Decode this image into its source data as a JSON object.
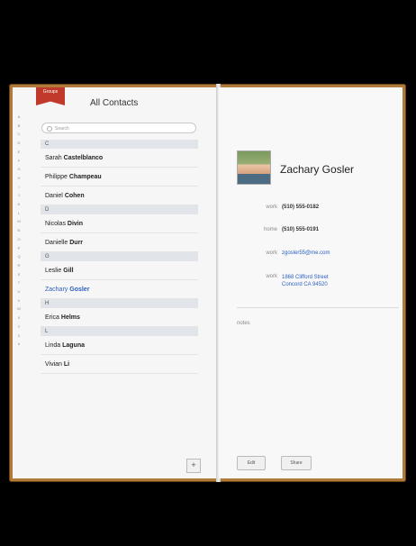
{
  "left_page": {
    "ribbon_label": "Groups",
    "title": "All Contacts",
    "search_placeholder": "Search",
    "index_letters": [
      "A",
      "B",
      "C",
      "D",
      "E",
      "F",
      "G",
      "H",
      "I",
      "J",
      "K",
      "L",
      "M",
      "N",
      "O",
      "P",
      "Q",
      "R",
      "S",
      "T",
      "U",
      "V",
      "W",
      "X",
      "Y",
      "Z",
      "#"
    ],
    "sections": [
      {
        "letter": "C",
        "rows": [
          {
            "first": "Sarah",
            "last": "Castelblanco"
          },
          {
            "first": "Philippe",
            "last": "Champeau"
          },
          {
            "first": "Daniel",
            "last": "Cohen"
          }
        ]
      },
      {
        "letter": "D",
        "rows": [
          {
            "first": "Nicolas",
            "last": "Divin"
          },
          {
            "first": "Danielle",
            "last": "Durr"
          }
        ]
      },
      {
        "letter": "G",
        "rows": [
          {
            "first": "Leslie",
            "last": "Gill"
          },
          {
            "first": "Zachary",
            "last": "Gosler",
            "selected": true
          }
        ]
      },
      {
        "letter": "H",
        "rows": [
          {
            "first": "Erica",
            "last": "Helms"
          }
        ]
      },
      {
        "letter": "L",
        "rows": [
          {
            "first": "Linda",
            "last": "Laguna"
          },
          {
            "first": "Vivian",
            "last": "Li"
          }
        ]
      }
    ],
    "add_label": "+"
  },
  "right_page": {
    "name": "Zachary Gosler",
    "fields": [
      {
        "label": "work",
        "value": "(510) 555-0182",
        "link": false
      },
      {
        "label": "home",
        "value": "(510) 555-0191",
        "link": false
      },
      {
        "label": "work",
        "value": "zgosler55@me.com",
        "link": true
      },
      {
        "label": "work",
        "value": "1868 Clifford Street\nConcord CA 94520",
        "link": true
      }
    ],
    "notes_label": "notes",
    "edit_label": "Edit",
    "share_label": "Share"
  }
}
